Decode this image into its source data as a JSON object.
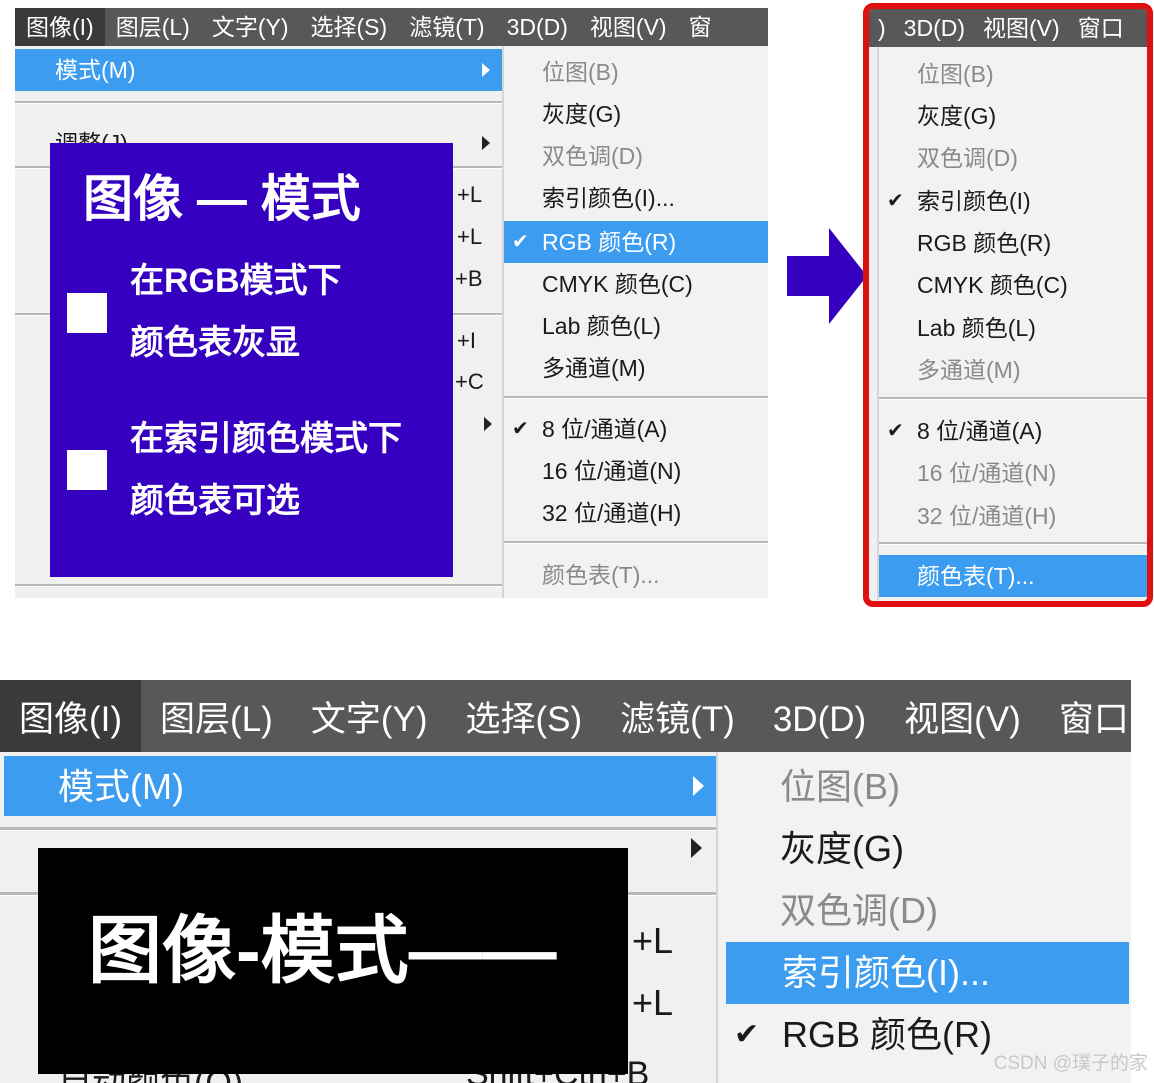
{
  "menubar": {
    "items": [
      "图像(I)",
      "图层(L)",
      "文字(Y)",
      "选择(S)",
      "滤镜(T)",
      "3D(D)",
      "视图(V)",
      "窗"
    ],
    "cropped_items": [
      ")",
      "3D(D)",
      "视图(V)",
      "窗口"
    ],
    "bottom_items": [
      "图像(I)",
      "图层(L)",
      "文字(Y)",
      "选择(S)",
      "滤镜(T)",
      "3D(D)",
      "视图(V)",
      "窗口"
    ]
  },
  "left_menu": {
    "mode": "模式(M)",
    "adjust": "调整(J)",
    "shortcuts": [
      "+L",
      "+L",
      "+B",
      "+I",
      "+C"
    ],
    "bottom_shortcuts": [
      "+L",
      "+L"
    ],
    "bottom_partial_item": "自动颜色(O)",
    "bottom_partial_shortcut": "Shift+Ctrl+B"
  },
  "mode_submenu_rgb": {
    "items": [
      {
        "label": "位图(B)",
        "disabled": true,
        "checked": false
      },
      {
        "label": "灰度(G)",
        "disabled": false,
        "checked": false
      },
      {
        "label": "双色调(D)",
        "disabled": true,
        "checked": false
      },
      {
        "label": "索引颜色(I)...",
        "disabled": false,
        "checked": false
      },
      {
        "label": "RGB 颜色(R)",
        "disabled": false,
        "checked": true,
        "highlighted": true
      },
      {
        "label": "CMYK 颜色(C)",
        "disabled": false,
        "checked": false
      },
      {
        "label": "Lab 颜色(L)",
        "disabled": false,
        "checked": false
      },
      {
        "label": "多通道(M)",
        "disabled": false,
        "checked": false
      }
    ],
    "bit_items": [
      {
        "label": "8 位/通道(A)",
        "checked": true
      },
      {
        "label": "16 位/通道(N)",
        "checked": false
      },
      {
        "label": "32 位/通道(H)",
        "checked": false
      }
    ],
    "color_table": "颜色表(T)..."
  },
  "mode_submenu_indexed": {
    "items": [
      {
        "label": "位图(B)",
        "disabled": true,
        "checked": false
      },
      {
        "label": "灰度(G)",
        "disabled": false,
        "checked": false
      },
      {
        "label": "双色调(D)",
        "disabled": true,
        "checked": false
      },
      {
        "label": "索引颜色(I)",
        "disabled": false,
        "checked": true
      },
      {
        "label": "RGB 颜色(R)",
        "disabled": false,
        "checked": false
      },
      {
        "label": "CMYK 颜色(C)",
        "disabled": false,
        "checked": false
      },
      {
        "label": "Lab 颜色(L)",
        "disabled": false,
        "checked": false
      },
      {
        "label": "多通道(M)",
        "disabled": true,
        "checked": false
      }
    ],
    "bit_items": [
      {
        "label": "8 位/通道(A)",
        "checked": true,
        "disabled": false
      },
      {
        "label": "16 位/通道(N)",
        "checked": false,
        "disabled": true
      },
      {
        "label": "32 位/通道(H)",
        "checked": false,
        "disabled": true
      }
    ],
    "color_table": "颜色表(T)..."
  },
  "mode_submenu_bottom": {
    "items": [
      {
        "label": "位图(B)",
        "disabled": true
      },
      {
        "label": "灰度(G)",
        "disabled": false
      },
      {
        "label": "双色调(D)",
        "disabled": true
      },
      {
        "label": "索引颜色(I)...",
        "disabled": false,
        "highlighted": true
      },
      {
        "label": "RGB 颜色(R)",
        "disabled": false,
        "checked": true
      }
    ]
  },
  "overlay_top": {
    "title": "图像 — 模式",
    "note1_line1": "在RGB模式下",
    "note1_line2": "颜色表灰显",
    "note2_line1": "在索引颜色模式下",
    "note2_line2": "颜色表可选"
  },
  "overlay_bottom": {
    "title": "图像-模式——"
  },
  "watermark": "CSDN @璞子的家",
  "colors": {
    "menubar": "#585858",
    "highlight": "#3c9cf0",
    "overlay_blue": "#3600c0",
    "frame_red": "#e01010"
  }
}
